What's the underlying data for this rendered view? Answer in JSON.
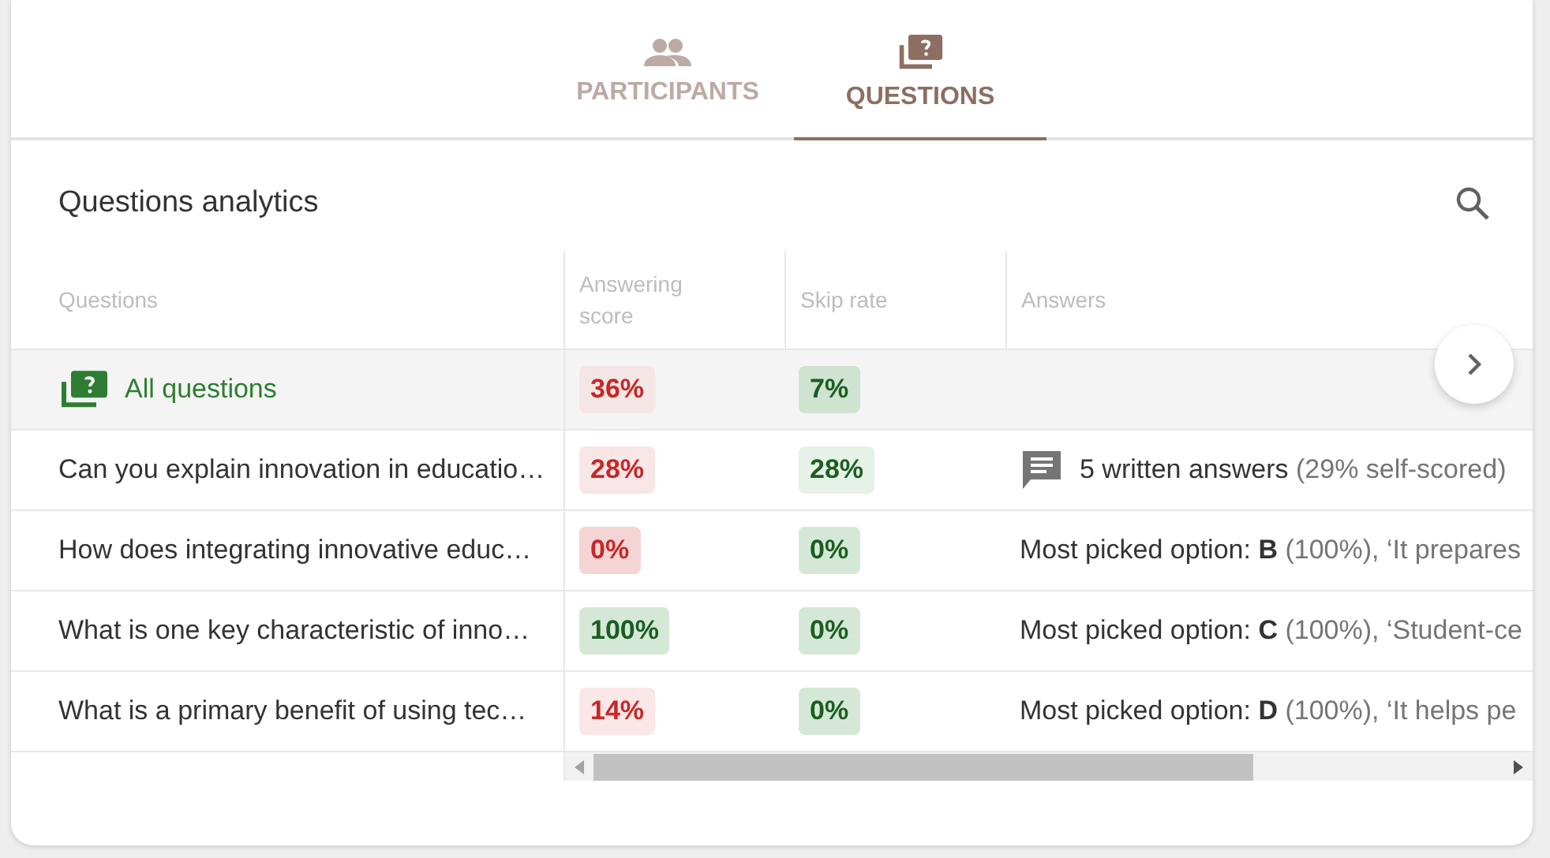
{
  "tabs": [
    {
      "label": "PARTICIPANTS",
      "kind": "people",
      "selected": false
    },
    {
      "label": "QUESTIONS",
      "kind": "question",
      "selected": true
    }
  ],
  "heading": "Questions analytics",
  "table": {
    "columns": [
      "Questions",
      "Answering score",
      "Skip rate",
      "Answers"
    ],
    "rows": [
      {
        "kind": "summary",
        "question": "All questions",
        "score": {
          "text": "36%",
          "color": "#f5e6e6"
        },
        "skip": {
          "text": "7%",
          "color": "#cfe3d1"
        }
      },
      {
        "kind": "written",
        "question": "Can you explain innovation in educatio…",
        "score": {
          "text": "28%",
          "color": "#f9e6e6"
        },
        "skip": {
          "text": "28%",
          "color": "#e6f2e7"
        },
        "answer": {
          "lead": "5 written answers",
          "note": "(29% self-scored)"
        }
      },
      {
        "kind": "choice",
        "question": "How does integrating innovative educ…",
        "score": {
          "text": "0%",
          "color": "#f4d4d4"
        },
        "skip": {
          "text": "0%",
          "color": "#d5e8d7"
        },
        "answer": {
          "lead": "Most picked option: **B**",
          "note": "(100%), ‘It prepares"
        }
      },
      {
        "kind": "choice",
        "question": "What is one key characteristic of inno…",
        "score": {
          "text": "100%",
          "color": "#d5e8d7"
        },
        "skip": {
          "text": "0%",
          "color": "#d5e8d7"
        },
        "answer": {
          "lead": "Most picked option: **C**",
          "note": "(100%), ‘Student-ce"
        }
      },
      {
        "kind": "choice",
        "question": "What is a primary benefit of using tec…",
        "score": {
          "text": "14%",
          "color": "#fbe7e7"
        },
        "skip": {
          "text": "0%",
          "color": "#d5e8d7"
        },
        "answer": {
          "lead": "Most picked option: **D**",
          "note": "(100%), ‘It helps pe"
        }
      }
    ]
  }
}
